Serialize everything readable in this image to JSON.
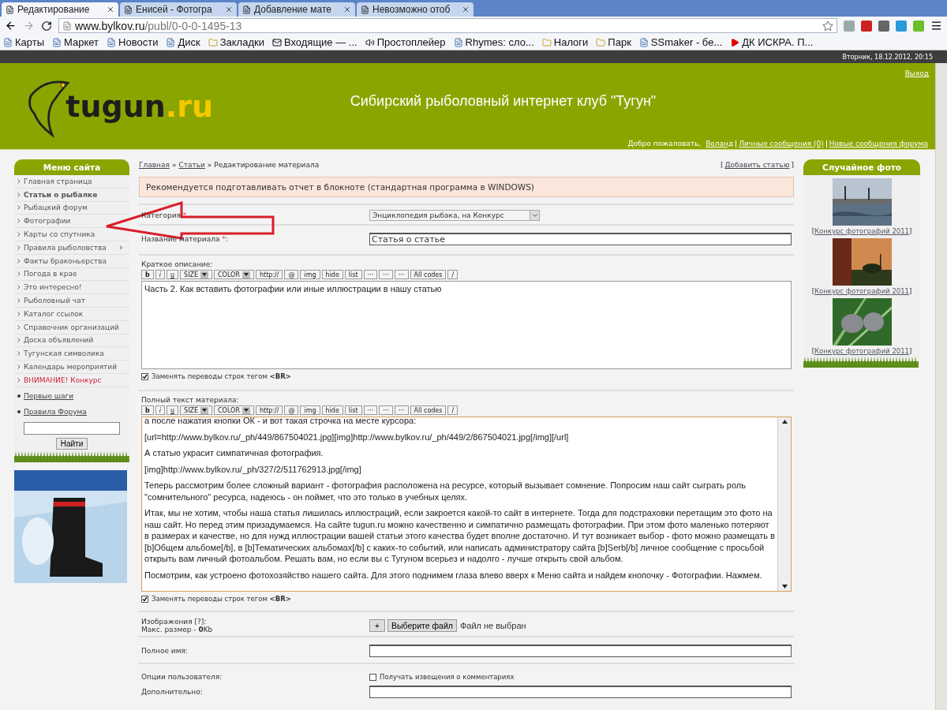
{
  "browser": {
    "tabs": [
      {
        "label": "Редактирование",
        "selected": true
      },
      {
        "label": "Енисей - Фотогра",
        "selected": false
      },
      {
        "label": "Добавление мате",
        "selected": false
      },
      {
        "label": "Невозможно отоб",
        "selected": false
      }
    ],
    "url_host": "www.bylkov.ru",
    "url_path": "/publ/0-0-0-1495-13",
    "bookmarks": [
      {
        "label": "Карты",
        "kind": "site"
      },
      {
        "label": "Маркет",
        "kind": "site"
      },
      {
        "label": "Новости",
        "kind": "site"
      },
      {
        "label": "Диск",
        "kind": "site"
      },
      {
        "label": "Закладки",
        "kind": "folder"
      },
      {
        "label": "Входящие — ...",
        "kind": "mail"
      },
      {
        "label": "Простоплейер",
        "kind": "audio"
      },
      {
        "label": "Rhymes: сло...",
        "kind": "site"
      },
      {
        "label": "Налоги",
        "kind": "folder"
      },
      {
        "label": "Парк",
        "kind": "folder"
      },
      {
        "label": "SSmaker - бе...",
        "kind": "site"
      },
      {
        "label": "ДК ИСКРА. П...",
        "kind": "video"
      }
    ]
  },
  "date": "Вторник, 18.12.2012, 20:15",
  "header": {
    "logo_main": "tugun",
    "logo_suffix": ".ru",
    "title": "Сибирский рыболовный интернет клуб \"Тугун\"",
    "logout": "Выход",
    "welcome": "Добро пожаловать,",
    "user_links": [
      "Воланд",
      "Личные сообщения (0)",
      "Новые сообщения форума"
    ]
  },
  "sidebar": {
    "title": "Меню сайта",
    "items": [
      {
        "label": "Главная страница",
        "selected": false,
        "submenu": false,
        "kind": "normal"
      },
      {
        "label": "Статьи о рыбалке",
        "selected": true,
        "submenu": false,
        "kind": "normal"
      },
      {
        "label": "Рыбацкий форум",
        "selected": false,
        "submenu": false,
        "kind": "normal"
      },
      {
        "label": "Фотографии",
        "selected": false,
        "submenu": false,
        "kind": "normal"
      },
      {
        "label": "Карты со спутника",
        "selected": false,
        "submenu": false,
        "kind": "normal"
      },
      {
        "label": "Правила рыболовства",
        "selected": false,
        "submenu": true,
        "kind": "normal"
      },
      {
        "label": "Факты браконьерства",
        "selected": false,
        "submenu": false,
        "kind": "normal"
      },
      {
        "label": "Погода в крае",
        "selected": false,
        "submenu": false,
        "kind": "normal"
      },
      {
        "label": "Это интересно!",
        "selected": false,
        "submenu": false,
        "kind": "normal"
      },
      {
        "label": "Рыболовный чат",
        "selected": false,
        "submenu": false,
        "kind": "normal"
      },
      {
        "label": "Каталог ссылок",
        "selected": false,
        "submenu": false,
        "kind": "normal"
      },
      {
        "label": "Справочник организаций",
        "selected": false,
        "submenu": false,
        "kind": "normal"
      },
      {
        "label": "Доска объявлений",
        "selected": false,
        "submenu": false,
        "kind": "normal"
      },
      {
        "label": "Тугунская символика",
        "selected": false,
        "submenu": false,
        "kind": "normal"
      },
      {
        "label": "Календарь мероприятий",
        "selected": false,
        "submenu": false,
        "kind": "normal"
      },
      {
        "label": "ВНИМАНИЕ! Конкурс",
        "selected": false,
        "submenu": false,
        "kind": "alert"
      }
    ],
    "links": [
      "Первые шаги",
      "Правила Форума"
    ],
    "search_button": "Найти",
    "ad": {
      "kind": "picture"
    }
  },
  "breadcrumb": [
    {
      "label": "Главная",
      "kind": "link"
    },
    {
      "label": "»",
      "kind": "separator"
    },
    {
      "label": "Статьи",
      "kind": "link"
    },
    {
      "label": "»",
      "kind": "separator"
    },
    {
      "label": "Редактирование материала",
      "kind": "current"
    }
  ],
  "add_link": {
    "open": "[",
    "label": "Добавить статью",
    "close": "]"
  },
  "notice": "Рекомендуется подготавливать отчет в блокноте (стандартная программа в WINDOWS)",
  "form": {
    "category_label": "Категория",
    "category_value": "Энциклопедия рыбака, на Конкурс",
    "title_label": "Название материала",
    "title_value": "Статья о статье",
    "required_mark": "*",
    "title_colon": ":",
    "short_toolbar": [
      {
        "label": "b",
        "kind": "button"
      },
      {
        "label": "i",
        "kind": "button"
      },
      {
        "label": "u",
        "kind": "button"
      },
      {
        "label": "SIZE",
        "kind": "select"
      },
      {
        "label": "COLOR",
        "kind": "select"
      },
      {
        "label": "http://",
        "kind": "button"
      },
      {
        "label": "@",
        "kind": "button"
      },
      {
        "label": "img",
        "kind": "button"
      },
      {
        "label": "hide",
        "kind": "button"
      },
      {
        "label": "list",
        "kind": "button"
      },
      {
        "label": "···",
        "kind": "button"
      },
      {
        "label": "···",
        "kind": "button"
      },
      {
        "label": "···",
        "kind": "button"
      },
      {
        "label": "All codes",
        "kind": "button"
      },
      {
        "label": "/",
        "kind": "button"
      }
    ],
    "short_label": "Краткое описание:",
    "short_text": "Часть 2. Как вставить фотографии или иные иллюстрации в нашу статью",
    "short_br": {
      "label": "Заменять переводы строк тегом",
      "tag": "<BR>",
      "checked": true
    },
    "full_label": "Полный текст материала:",
    "full_toolbar": [
      {
        "label": "b",
        "kind": "button"
      },
      {
        "label": "i",
        "kind": "button"
      },
      {
        "label": "u",
        "kind": "button"
      },
      {
        "label": "SIZE",
        "kind": "select"
      },
      {
        "label": "COLOR",
        "kind": "select"
      },
      {
        "label": "http://",
        "kind": "button"
      },
      {
        "label": "@",
        "kind": "button"
      },
      {
        "label": "img",
        "kind": "button"
      },
      {
        "label": "hide",
        "kind": "button"
      },
      {
        "label": "list",
        "kind": "button"
      },
      {
        "label": "···",
        "kind": "button"
      },
      {
        "label": "···",
        "kind": "button"
      },
      {
        "label": "···",
        "kind": "button"
      },
      {
        "label": "All codes",
        "kind": "button"
      },
      {
        "label": "/",
        "kind": "button"
      }
    ],
    "full_text": [
      "а после нажатия кнопки ОК - и вот такая строчка на месте курсора:",
      "[url=http://www.bylkov.ru/_ph/449/867504021.jpg][img]http://www.bylkov.ru/_ph/449/2/867504021.jpg[/img][/url]",
      "А статью украсит симпатичная фотография.",
      "[img]http://www.bylkov.ru/_ph/327/2/511762913.jpg[/img]",
      "Теперь рассмотрим более сложный вариант - фотография расположена на ресурсе, который вызывает сомнение. Попросим наш сайт сыграть роль \"сомнительного\" ресурса, надеюсь - он поймет, что это только в учебных целях.",
      "Итак, мы не хотим, чтобы наша статья лишилась иллюстраций, если закроется какой-то сайт в интернете. Тогда для подстраховки перетащим это фото на наш сайт. Но перед этим призадумаемся. На сайте tugun.ru можно качественно и симпатично размещать фотографии. При этом фото маленько потеряют в размерах и качестве, но для нужд иллюстрации вашей статьи этого качества будет вполне достаточно. И тут возникает выбор - фото можно размещать в [b]Общем альбоме[/b], в [b]Тематических альбомах[/b] с каких-то событий, или написать  администратору сайта [b]Serb[/b] личное сообщение с просьбой открыть вам личный фотоальбом. Решать вам, но если вы с Тугуном всерьез и надолго - лучше открыть свой альбом.",
      "Посмотрим, как устроено фотохозяйство нашего сайта. Для этого поднимем глаза влево вверх к Меню сайта и найдем кнопочку - Фотографии. Нажмем."
    ],
    "full_br": {
      "label": "Заменять переводы строк тегом",
      "tag": "<BR>",
      "checked": true
    },
    "images_label": "Изображения [?]:",
    "images_size": "Макс. размер - **0**Kb",
    "add_button": "+",
    "file_button": "Выберите файл",
    "file_status": "Файл не выбран",
    "name_label": "Полное имя:",
    "options_label": "Опции пользователя:",
    "notify": {
      "label": "Получать извещения о комментариях",
      "checked": false
    },
    "extra_label": "Дополнительно:"
  },
  "random_photo": {
    "title": "Случайное фото",
    "items": [
      {
        "open": "[",
        "caption": "Конкурс фотографий 2011",
        "close": "]",
        "kind": "harbor"
      },
      {
        "open": "[",
        "caption": "Конкурс фотографий 2011",
        "close": "]",
        "kind": "sunset"
      },
      {
        "open": "[",
        "caption": "Конкурс фотографий 2011",
        "close": "]",
        "kind": "cones"
      }
    ]
  }
}
